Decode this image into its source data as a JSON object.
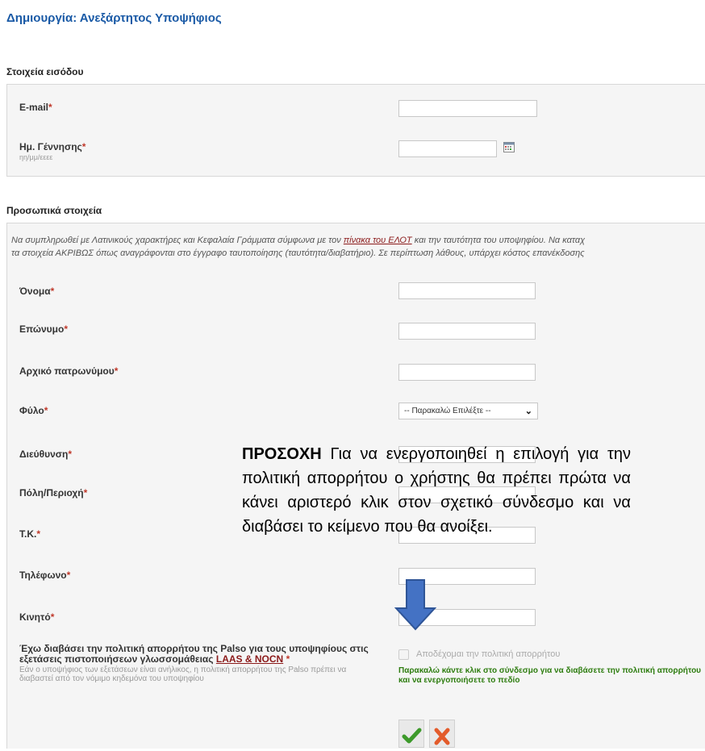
{
  "page": {
    "title": "Δημιουργία: Ανεξάρτητος Υποψήφιος"
  },
  "login_section": {
    "title": "Στοιχεία εισόδου",
    "email_label": "E-mail",
    "dob_label": "Ημ. Γέννησης",
    "dob_hint": "ηη/μμ/εεεε",
    "required_mark": "*"
  },
  "personal_section": {
    "title": "Προσωπικά στοιχεία",
    "note_part1": "Να συμπληρωθεί με Λατινικούς χαρακτήρες και Κεφαλαία Γράμματα σύμφωνα με τον ",
    "note_link": "πίνακα του ΕΛΟΤ",
    "note_part2": " και την ταυτότητα του υποψηφίου. Να καταχ",
    "note_line2": "τα στοιχεία ΑΚΡΙΒΩΣ όπως αναγράφονται στο έγγραφο ταυτοποίησης (ταυτότητα/διαβατήριο). Σε περίπτωση λάθους, υπάρχει κόστος επανέκδοσης",
    "first_name_label": "Όνομα",
    "last_name_label": "Επώνυμο",
    "father_initial_label": "Αρχικό πατρωνύμου",
    "gender_label": "Φύλο",
    "gender_selected": "-- Παρακαλώ Επιλέξτε --",
    "address_label": "Διεύθυνση",
    "city_label": "Πόλη/Περιοχή",
    "postal_label": "Τ.Κ.",
    "phone_label": "Τηλέφωνο",
    "mobile_label": "Κινητό"
  },
  "privacy": {
    "label_text": "Έχω διαβάσει την πολιτική απορρήτου της Palso για τους υποψηφίους στις εξετάσεις πιστοποιήσεων γλωσσομάθειας ",
    "label_link": "LAAS & NOCN",
    "hint": "Εάν ο υποψήφιος των εξετάσεων είναι ανήλικος, η πολιτική απορρήτου της Palso πρέπει να διαβαστεί από τον νόμιμο κηδεμόνα του υποψηφίου",
    "checkbox_label": "Αποδέχομαι την πολιτική απορρήτου",
    "message": "Παρακαλώ κάντε κλικ στο σύνδεσμο για να διαβάσετε την πολιτική απορρήτου και να ενεργοποιήσετε το πεδίο"
  },
  "overlay": {
    "bold": "ΠΡΟΣΟΧΗ",
    "text": " Για να ενεργοποιηθεί η επιλογή  για την πολιτική απορρήτου ο χρήστης θα πρέπει πρώτα να κάνει αριστερό κλικ στον σχετικό σύνδεσμο και να διαβάσει το κείμενο που θα ανοίξει."
  },
  "buttons": {
    "submit_icon": "check-icon",
    "cancel_icon": "cross-icon"
  },
  "colors": {
    "title": "#1a5aa6",
    "required": "#c0392b",
    "link": "#8b1a1a",
    "message": "#2e7d10",
    "arrow": "#4472c4"
  }
}
